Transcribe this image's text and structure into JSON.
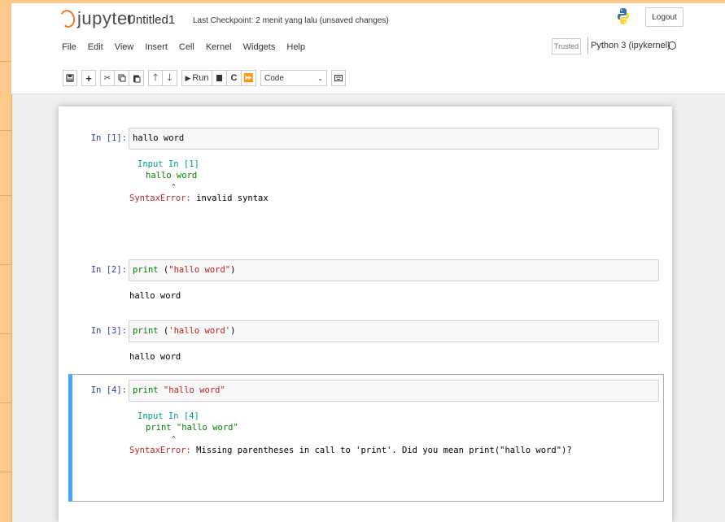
{
  "header": {
    "logo_text": "jupyter",
    "notebook_name": "Untitled1",
    "checkpoint": "Last Checkpoint: 2 menit yang lalu  (unsaved changes)",
    "logout_label": "Logout"
  },
  "menu": {
    "items": [
      "File",
      "Edit",
      "View",
      "Insert",
      "Cell",
      "Kernel",
      "Widgets",
      "Help"
    ],
    "trusted": "Trusted",
    "kernel": "Python 3 (ipykernel)"
  },
  "toolbar": {
    "run_label": "Run",
    "cell_type": "Code"
  },
  "cells": [
    {
      "prompt": "In [1]:",
      "source": "hallo word",
      "output": {
        "header": "Input In [1]",
        "code": "hallo word",
        "caret": "^",
        "error_name": "SyntaxError:",
        "error_msg": " invalid syntax"
      }
    },
    {
      "prompt": "In [2]:",
      "source_kw": "print",
      "source_rest_open": " (",
      "source_str": "\"hallo word\"",
      "source_close": ")",
      "output": "hallo word"
    },
    {
      "prompt": "In [3]:",
      "source_kw": "print",
      "source_rest_open": " (",
      "source_str": "'hallo word'",
      "source_close": ")",
      "output": "hallo word"
    },
    {
      "prompt": "In [4]:",
      "source_kw": "print",
      "source_str": " \"hallo word\"",
      "output": {
        "header": "Input In [4]",
        "code": "print \"hallo word\"",
        "caret": "^",
        "error_name": "SyntaxError:",
        "error_msg": " Missing parentheses in call to 'print'. Did you mean print(\"hallo word\")?"
      }
    }
  ],
  "colors": {
    "frame": "#fdc98a",
    "selected_cell_bar": "#42a5f5",
    "prompt": "#303f9f"
  }
}
